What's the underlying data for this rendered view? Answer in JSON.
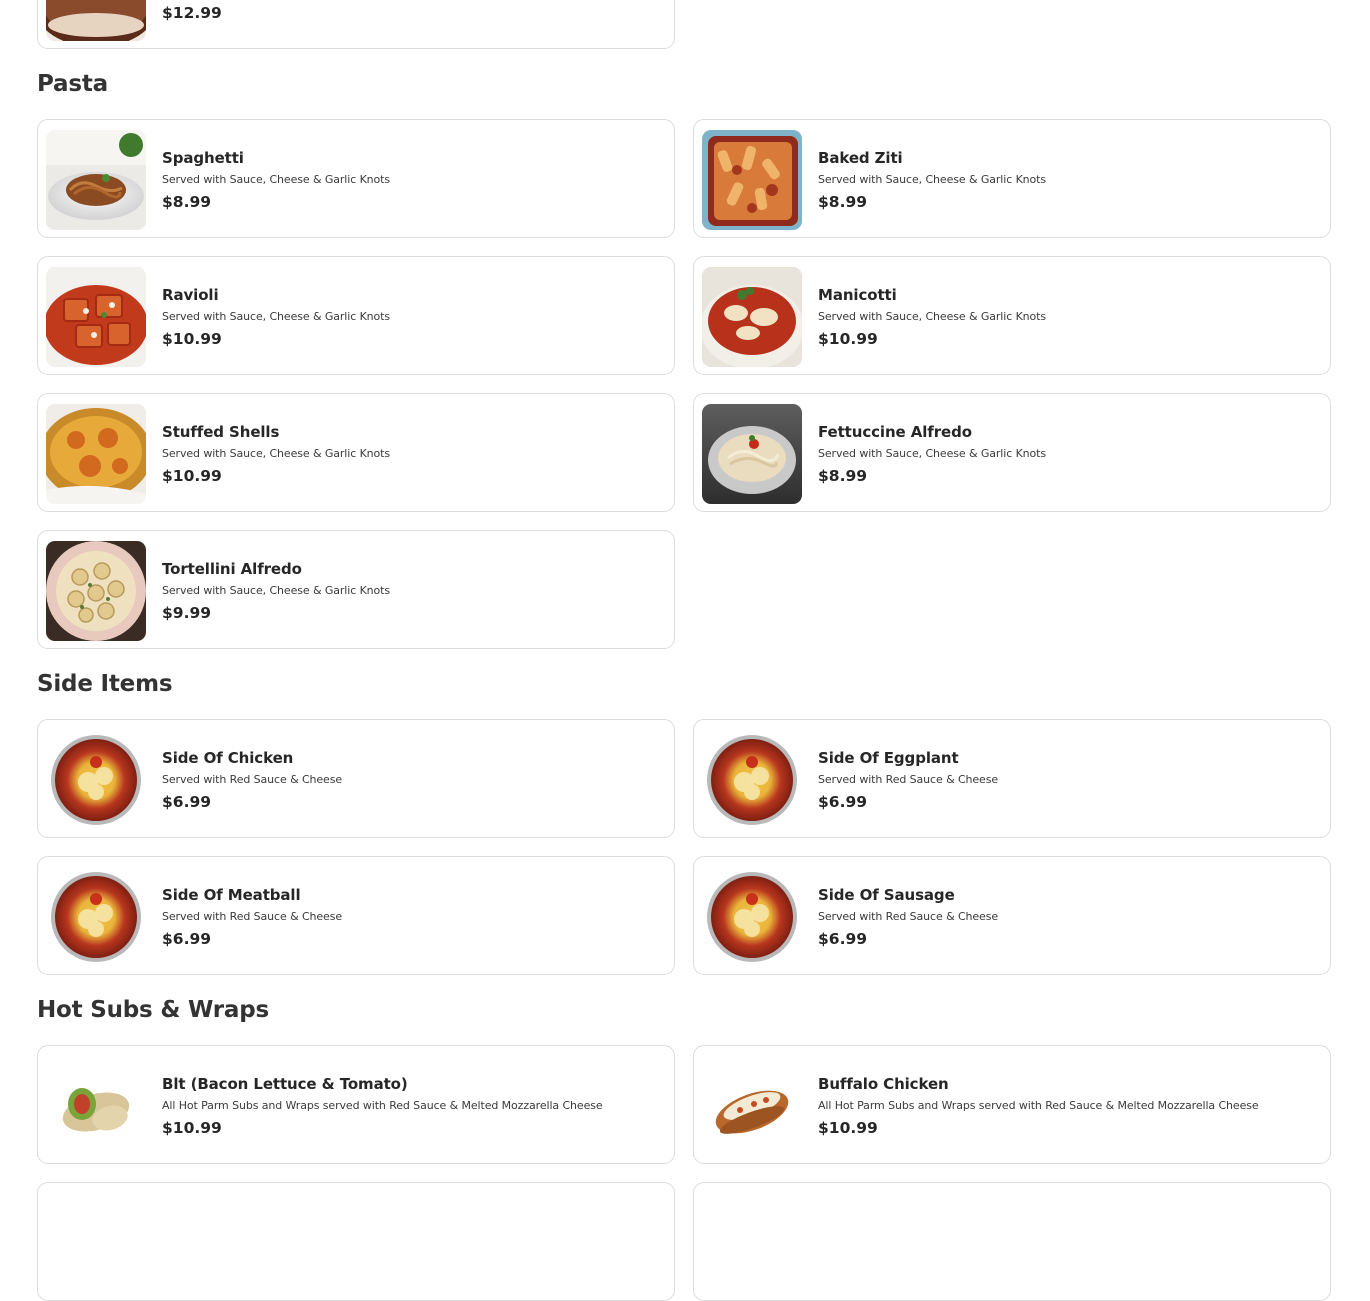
{
  "top_partial": {
    "price": "$12.99"
  },
  "sections": [
    {
      "title": "Pasta",
      "items": [
        {
          "name": "Spaghetti",
          "desc": "Served with Sauce, Cheese & Garlic Knots",
          "price": "$8.99",
          "image": "spaghetti-photo"
        },
        {
          "name": "Baked Ziti",
          "desc": "Served with Sauce, Cheese & Garlic Knots",
          "price": "$8.99",
          "image": "baked-ziti-photo"
        },
        {
          "name": "Ravioli",
          "desc": "Served with Sauce, Cheese & Garlic Knots",
          "price": "$10.99",
          "image": "ravioli-photo"
        },
        {
          "name": "Manicotti",
          "desc": "Served with Sauce, Cheese & Garlic Knots",
          "price": "$10.99",
          "image": "manicotti-photo"
        },
        {
          "name": "Stuffed Shells",
          "desc": "Served with Sauce, Cheese & Garlic Knots",
          "price": "$10.99",
          "image": "stuffed-shells-photo"
        },
        {
          "name": "Fettuccine Alfredo",
          "desc": "Served with Sauce, Cheese & Garlic Knots",
          "price": "$8.99",
          "image": "fettuccine-photo"
        },
        {
          "name": "Tortellini Alfredo",
          "desc": "Served with Sauce, Cheese & Garlic Knots",
          "price": "$9.99",
          "image": "tortellini-photo"
        }
      ]
    },
    {
      "title": "Side Items",
      "items": [
        {
          "name": "Side Of Chicken",
          "desc": "Served with Red Sauce & Cheese",
          "price": "$6.99",
          "image": "side-tray-photo"
        },
        {
          "name": "Side Of Eggplant",
          "desc": "Served with Red Sauce & Cheese",
          "price": "$6.99",
          "image": "side-tray-photo"
        },
        {
          "name": "Side Of Meatball",
          "desc": "Served with Red Sauce & Cheese",
          "price": "$6.99",
          "image": "side-tray-photo"
        },
        {
          "name": "Side Of Sausage",
          "desc": "Served with Red Sauce & Cheese",
          "price": "$6.99",
          "image": "side-tray-photo"
        }
      ]
    },
    {
      "title": "Hot Subs & Wraps",
      "items": [
        {
          "name": "Blt (Bacon Lettuce & Tomato)",
          "desc": "All Hot Parm Subs and Wraps served with Red Sauce & Melted Mozzarella Cheese",
          "price": "$10.99",
          "image": "wrap-photo"
        },
        {
          "name": "Buffalo Chicken",
          "desc": "All Hot Parm Subs and Wraps served with Red Sauce & Melted Mozzarella Cheese",
          "price": "$10.99",
          "image": "sub-photo"
        }
      ]
    }
  ]
}
